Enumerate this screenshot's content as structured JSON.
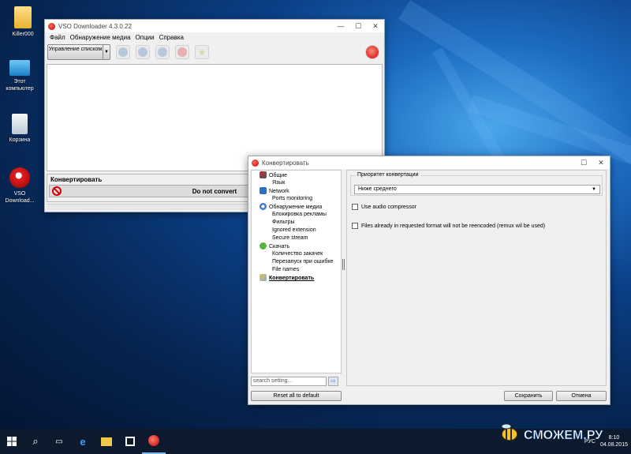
{
  "desktop": {
    "icons": [
      {
        "label": "Killer000",
        "icon": "folder-icon"
      },
      {
        "label": "Этот компьютер",
        "icon": "computer-icon"
      },
      {
        "label": "Корзина",
        "icon": "recycle-bin-icon"
      },
      {
        "label": "VSO Download...",
        "icon": "vso-shortcut-icon"
      }
    ]
  },
  "main_window": {
    "title": "VSO Downloader 4.3.0.22",
    "menu": [
      "Файл",
      "Обнаружение медиа",
      "Опции",
      "Справка"
    ],
    "manage_button": "Управление списком",
    "convert_header": "Конвертировать",
    "convert_value": "Do not convert"
  },
  "dialog": {
    "title": "Конвертировать",
    "tree": [
      {
        "label": "Общие",
        "level": 0,
        "icon": "tools-icon"
      },
      {
        "label": "Язык",
        "level": 1
      },
      {
        "label": "Network",
        "level": 0,
        "icon": "network-icon"
      },
      {
        "label": "Ports monitoring",
        "level": 1
      },
      {
        "label": "Обнаружение медиа",
        "level": 0,
        "icon": "detect-media-icon"
      },
      {
        "label": "Блокировка рекламы",
        "level": 1
      },
      {
        "label": "Фильтры",
        "level": 1
      },
      {
        "label": "Ignored extension",
        "level": 1
      },
      {
        "label": "Secure stream",
        "level": 1
      },
      {
        "label": "Скачать",
        "level": 0,
        "icon": "download-icon"
      },
      {
        "label": "Количество закачек",
        "level": 1
      },
      {
        "label": "Перезапуск при ошибке",
        "level": 1
      },
      {
        "label": "File names",
        "level": 1
      },
      {
        "label": "Конвертировать",
        "level": 0,
        "icon": "convert-icon",
        "selected": true
      }
    ],
    "search_placeholder": "search setting...",
    "reset_button": "Reset all to default",
    "priority_group_title": "Приоритет конвертации",
    "priority_value": "Ниже среднего",
    "use_audio_compressor": "Use audio compressor",
    "skip_reencode": "Files already in requested format will not be reencoded (remux wil be used)",
    "save_button": "Сохранить",
    "cancel_button": "Отмена"
  },
  "taskbar": {
    "language": "РУС",
    "time": "8:10",
    "date": "04.08.2015"
  },
  "watermark": "СМОЖЕМ.РУ",
  "colors": {
    "accent_red": "#d40000",
    "desktop_blue": "#0b3f86",
    "taskbar": "#0d1a2e"
  }
}
